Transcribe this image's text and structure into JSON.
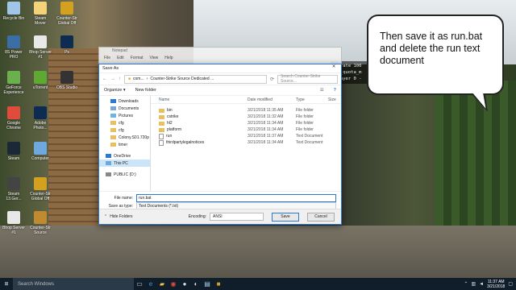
{
  "desktop_icons": [
    {
      "label": "Recycle Bin",
      "icon": "recycle-bin-icon",
      "color": "#9fc5e8"
    },
    {
      "label": "Steam\nMover",
      "icon": "folder-icon",
      "color": "#f3d27a"
    },
    {
      "label": "Counter-Str\nGlobal Off",
      "icon": "csgo-icon",
      "color": "#d4a020"
    },
    {
      "label": "8S Power\nPRO",
      "icon": "app-icon",
      "color": "#3a6ea5"
    },
    {
      "label": "Bhop Server\n#1",
      "icon": "file-icon",
      "color": "#e8e8e8"
    },
    {
      "label": "Ps",
      "icon": "photoshop-icon",
      "color": "#0e2b50"
    },
    {
      "label": "GeForce\nExperience",
      "icon": "geforce-icon",
      "color": "#6ab04c"
    },
    {
      "label": "uTorrent",
      "icon": "utorrent-icon",
      "color": "#5fa833"
    },
    {
      "label": "OBS Studio",
      "icon": "obs-icon",
      "color": "#333333"
    },
    {
      "label": "Google\nChrome",
      "icon": "chrome-icon",
      "color": "#e04c3c"
    },
    {
      "label": "Adobe\nPhoto...",
      "icon": "photoshop-icon",
      "color": "#0e2b50"
    },
    {
      "label": "Steam",
      "icon": "steam-icon",
      "color": "#1b2838"
    },
    {
      "label": "Computer",
      "icon": "computer-icon",
      "color": "#6fa8dc"
    },
    {
      "label": "Steam\n13.Ger...",
      "icon": "app-icon",
      "color": "#444444"
    },
    {
      "label": "Counter-Str\nGlobal Off",
      "icon": "csgo-icon",
      "color": "#d4a020"
    },
    {
      "label": "Bhop Server\n#1",
      "icon": "file-icon",
      "color": "#e8e8e8"
    },
    {
      "label": "Counter-Str\nSource",
      "icon": "css-icon",
      "color": "#c08a30"
    }
  ],
  "console_lines": [
    "elerate 100",
    "net_quota_m",
    "_player 0 -"
  ],
  "bubble_text": "Then save it as run.bat and delete the run text document",
  "background_window": {
    "title": "Notepad",
    "menu": [
      "File",
      "Edit",
      "Format",
      "View",
      "Help"
    ]
  },
  "dialog": {
    "title": "Save As",
    "path": [
      "com...",
      "Counter-Strike Source Dedicated ..."
    ],
    "search_placeholder": "Search Counter-Strike Source...",
    "organize": "Organize ▾",
    "new_folder": "New folder",
    "nav": [
      {
        "label": "Downloads",
        "icon": "downloads-icon",
        "sub": true,
        "selected": false
      },
      {
        "label": "Documents",
        "icon": "documents-icon",
        "sub": true,
        "selected": false
      },
      {
        "label": "Pictures",
        "icon": "pictures-icon",
        "sub": true,
        "selected": false
      },
      {
        "label": "cfg",
        "icon": "folder-icon",
        "sub": true,
        "selected": false
      },
      {
        "label": "cfg",
        "icon": "folder-icon",
        "sub": true,
        "selected": false
      },
      {
        "label": "Colony.S01.720p",
        "icon": "folder-icon",
        "sub": true,
        "selected": false
      },
      {
        "label": "timer",
        "icon": "folder-icon",
        "sub": true,
        "selected": false
      },
      {
        "label": "OneDrive",
        "icon": "onedrive-icon",
        "sub": false,
        "selected": false
      },
      {
        "label": "This PC",
        "icon": "pc-icon",
        "sub": false,
        "selected": true
      },
      {
        "label": "PUBLIC (D:)",
        "icon": "drive-icon",
        "sub": false,
        "selected": false
      }
    ],
    "columns": [
      "Name",
      "Date modified",
      "Type",
      "Size"
    ],
    "files": [
      {
        "name": "bin",
        "date": "3/21/2018 11:35 AM",
        "type": "File folder",
        "folder": true
      },
      {
        "name": "cstrike",
        "date": "3/21/2018 11:32 AM",
        "type": "File folder",
        "folder": true
      },
      {
        "name": "hl2",
        "date": "3/21/2018 11:34 AM",
        "type": "File folder",
        "folder": true
      },
      {
        "name": "platform",
        "date": "3/21/2018 11:34 AM",
        "type": "File folder",
        "folder": true
      },
      {
        "name": "run",
        "date": "3/21/2018 11:37 AM",
        "type": "Text Document",
        "folder": false
      },
      {
        "name": "thirdpartylegalnotices",
        "date": "3/21/2018 11:34 AM",
        "type": "Text Document",
        "folder": false
      }
    ],
    "file_name_label": "File name:",
    "file_name_value": "run.bat",
    "save_as_type_label": "Save as type:",
    "save_as_type_value": "Text Documents (*.txt)",
    "hide_folders": "Hide Folders",
    "encoding_label": "Encoding:",
    "encoding_value": "ANSI",
    "save": "Save",
    "cancel": "Cancel"
  },
  "taskbar": {
    "search_placeholder": "Search Windows",
    "time": "11:37 AM",
    "date": "3/21/2018"
  }
}
